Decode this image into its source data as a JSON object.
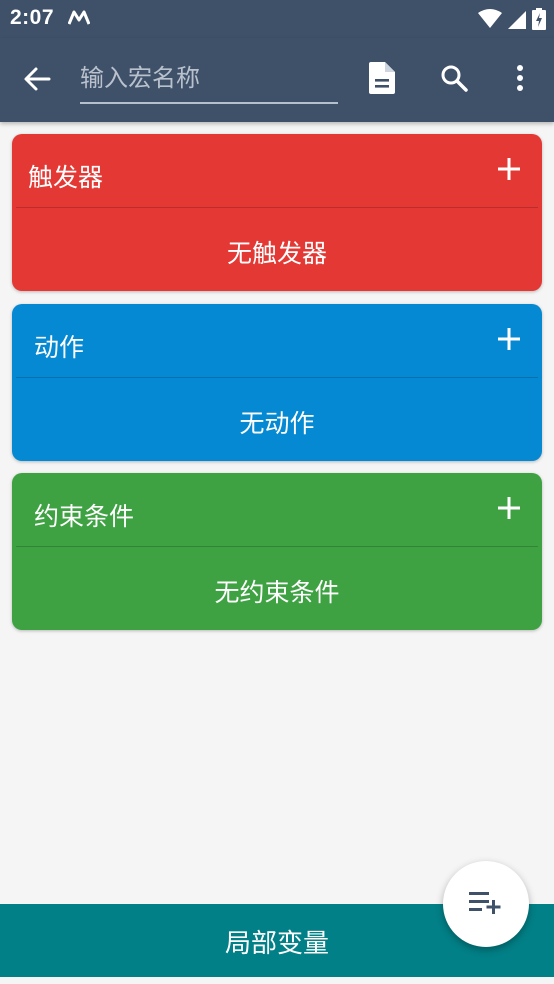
{
  "status_bar": {
    "time": "2:07",
    "app_icon": "m-app-icon",
    "icons": [
      "wifi-icon",
      "signal-icon",
      "battery-charging-icon"
    ]
  },
  "toolbar": {
    "back_icon": "arrow-back-icon",
    "name_placeholder": "输入宏名称",
    "name_value": "",
    "doc_icon": "document-icon",
    "search_icon": "search-icon",
    "more_icon": "more-vert-icon"
  },
  "sections": {
    "triggers": {
      "title": "触发器",
      "empty_text": "无触发器",
      "color": "#e43834"
    },
    "actions": {
      "title": "动作",
      "empty_text": "无动作",
      "color": "#0589d2"
    },
    "constraints": {
      "title": "约束条件",
      "empty_text": "无约束条件",
      "color": "#3ea243"
    }
  },
  "bottom_bar": {
    "label": "局部变量",
    "color": "#028087"
  },
  "fab": {
    "icon": "playlist-add-icon"
  },
  "colors": {
    "toolbar": "#3f5069",
    "background": "#f5f5f5"
  }
}
